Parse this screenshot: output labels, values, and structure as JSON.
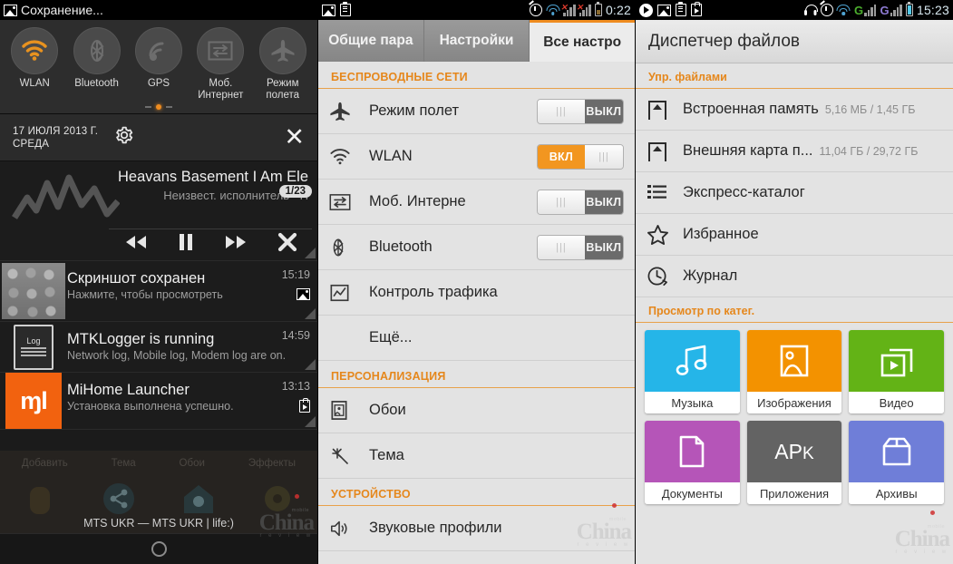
{
  "panel1": {
    "statusbar": {
      "title": "Сохранение...",
      "icon": "image-saving-icon"
    },
    "toggles": [
      {
        "label": "WLAN",
        "icon": "wifi-icon",
        "state": "on"
      },
      {
        "label": "Bluetooth",
        "icon": "bluetooth-icon",
        "state": "off"
      },
      {
        "label": "GPS",
        "icon": "gps-icon",
        "state": "off"
      },
      {
        "label": "Моб. Интернет",
        "icon": "mobile-data-icon",
        "state": "off"
      },
      {
        "label": "Режим полета",
        "icon": "airplane-icon",
        "state": "off"
      }
    ],
    "date": {
      "line1": "17 ИЮЛЯ 2013 Г.",
      "line2": "СРЕДА"
    },
    "actions": {
      "settings": "gear-icon",
      "clear": "close-icon"
    },
    "music": {
      "title": "Heavans Basement I Am Ele",
      "subtitle": "Неизвест. исполнитель - Н",
      "counter": "1/23",
      "controls": [
        "prev-button",
        "pause-button",
        "next-button",
        "close-button"
      ]
    },
    "notifications": [
      {
        "title": "Скриншот сохранен",
        "subtitle": "Нажмите, чтобы просмотреть",
        "time": "15:19",
        "icon": "screenshot-thumbnail"
      },
      {
        "title": "MTKLogger is running",
        "subtitle": "Network log, Mobile log, Modem log are on.",
        "time": "14:59",
        "icon": "log-icon"
      },
      {
        "title": "MiHome Launcher",
        "subtitle": "Установка выполнена успешно.",
        "time": "13:13",
        "icon": "mi-logo"
      }
    ],
    "homescreen": {
      "labels": [
        "Добавить",
        "Тема",
        "Обои",
        "Эффекты"
      ],
      "carrier": "MTS UKR — MTS UKR  |  life:)"
    },
    "watermark": {
      "main": "China",
      "sub": "r e v i e w",
      "tag": "mobile"
    }
  },
  "panel2": {
    "statusbar": {
      "time": "0:22",
      "left_icons": [
        "image-icon",
        "clipboard-icon"
      ],
      "right_icons": [
        "alarm-icon",
        "wifi-icon",
        "signal-disabled-icon",
        "signal-disabled-icon",
        "battery-icon"
      ]
    },
    "tabs": [
      {
        "label": "Общие пара",
        "active": false
      },
      {
        "label": "Настройки",
        "active": false
      },
      {
        "label": "Все настро",
        "active": true
      }
    ],
    "sections": [
      {
        "header": "БЕСПРОВОДНЫЕ СЕТИ",
        "rows": [
          {
            "label": "Режим полет",
            "icon": "airplane-icon",
            "switch": "ВЫКЛ",
            "state": "off"
          },
          {
            "label": "WLAN",
            "icon": "wifi-icon",
            "switch": "ВКЛ",
            "state": "on"
          },
          {
            "label": "Моб. Интерне",
            "icon": "mobile-data-icon",
            "switch": "ВЫКЛ",
            "state": "off"
          },
          {
            "label": "Bluetooth",
            "icon": "bluetooth-icon",
            "switch": "ВЫКЛ",
            "state": "off"
          },
          {
            "label": "Контроль трафика",
            "icon": "traffic-chart-icon",
            "switch": null,
            "state": null
          },
          {
            "label": "Ещё...",
            "icon": null,
            "switch": null,
            "state": null
          }
        ]
      },
      {
        "header": "ПЕРСОНАЛИЗАЦИЯ",
        "rows": [
          {
            "label": "Обои",
            "icon": "wallpaper-icon",
            "switch": null,
            "state": null
          },
          {
            "label": "Тема",
            "icon": "theme-wand-icon",
            "switch": null,
            "state": null
          }
        ]
      },
      {
        "header": "УСТРОЙСТВО",
        "rows": [
          {
            "label": "Звуковые профили",
            "icon": "speaker-icon",
            "switch": null,
            "state": null
          }
        ]
      }
    ],
    "watermark": {
      "main": "China",
      "sub": "r e v i e w",
      "tag": "mobile"
    }
  },
  "panel3": {
    "statusbar": {
      "time": "15:23",
      "left_icons": [
        "play-icon",
        "image-icon",
        "clipboard-icon",
        "store-icon"
      ],
      "right_icons": [
        "headset-icon",
        "alarm-icon",
        "wifi-icon",
        "gprs-signal-icon",
        "gprs-signal-icon",
        "battery-icon"
      ]
    },
    "title": "Диспетчер файлов",
    "section_manage": "Упр. файлами",
    "storage": [
      {
        "label": "Встроенная память",
        "meta": "5,16 МБ / 1,45 ГБ",
        "icon": "folder-storage-icon"
      },
      {
        "label": "Внешняя карта п...",
        "meta": "11,04 ГБ / 29,72 ГБ",
        "icon": "folder-storage-icon"
      }
    ],
    "shortcuts": [
      {
        "label": "Экспресс-каталог",
        "icon": "list-icon"
      },
      {
        "label": "Избранное",
        "icon": "star-icon"
      },
      {
        "label": "Журнал",
        "icon": "history-clock-icon"
      }
    ],
    "section_categories": "Просмотр по катег.",
    "categories": [
      {
        "label": "Музыка",
        "icon": "music-note-icon",
        "color": "#25b5e8"
      },
      {
        "label": "Изображения",
        "icon": "picture-icon",
        "color": "#f39200"
      },
      {
        "label": "Видео",
        "icon": "video-play-icon",
        "color": "#63b316"
      },
      {
        "label": "Документы",
        "icon": "document-icon",
        "color": "#b css"
      },
      {
        "label": "Приложения",
        "icon": "apk-icon",
        "color": "#636363"
      },
      {
        "label": "Архивы",
        "icon": "archive-box-icon",
        "color": "#6f7ed8"
      }
    ],
    "category_colors": [
      "#25b5e8",
      "#f39200",
      "#63b316",
      "#b555b8",
      "#636363",
      "#6f7ed8"
    ],
    "watermark": {
      "main": "China",
      "sub": "r e v i e w",
      "tag": "mobile"
    }
  }
}
